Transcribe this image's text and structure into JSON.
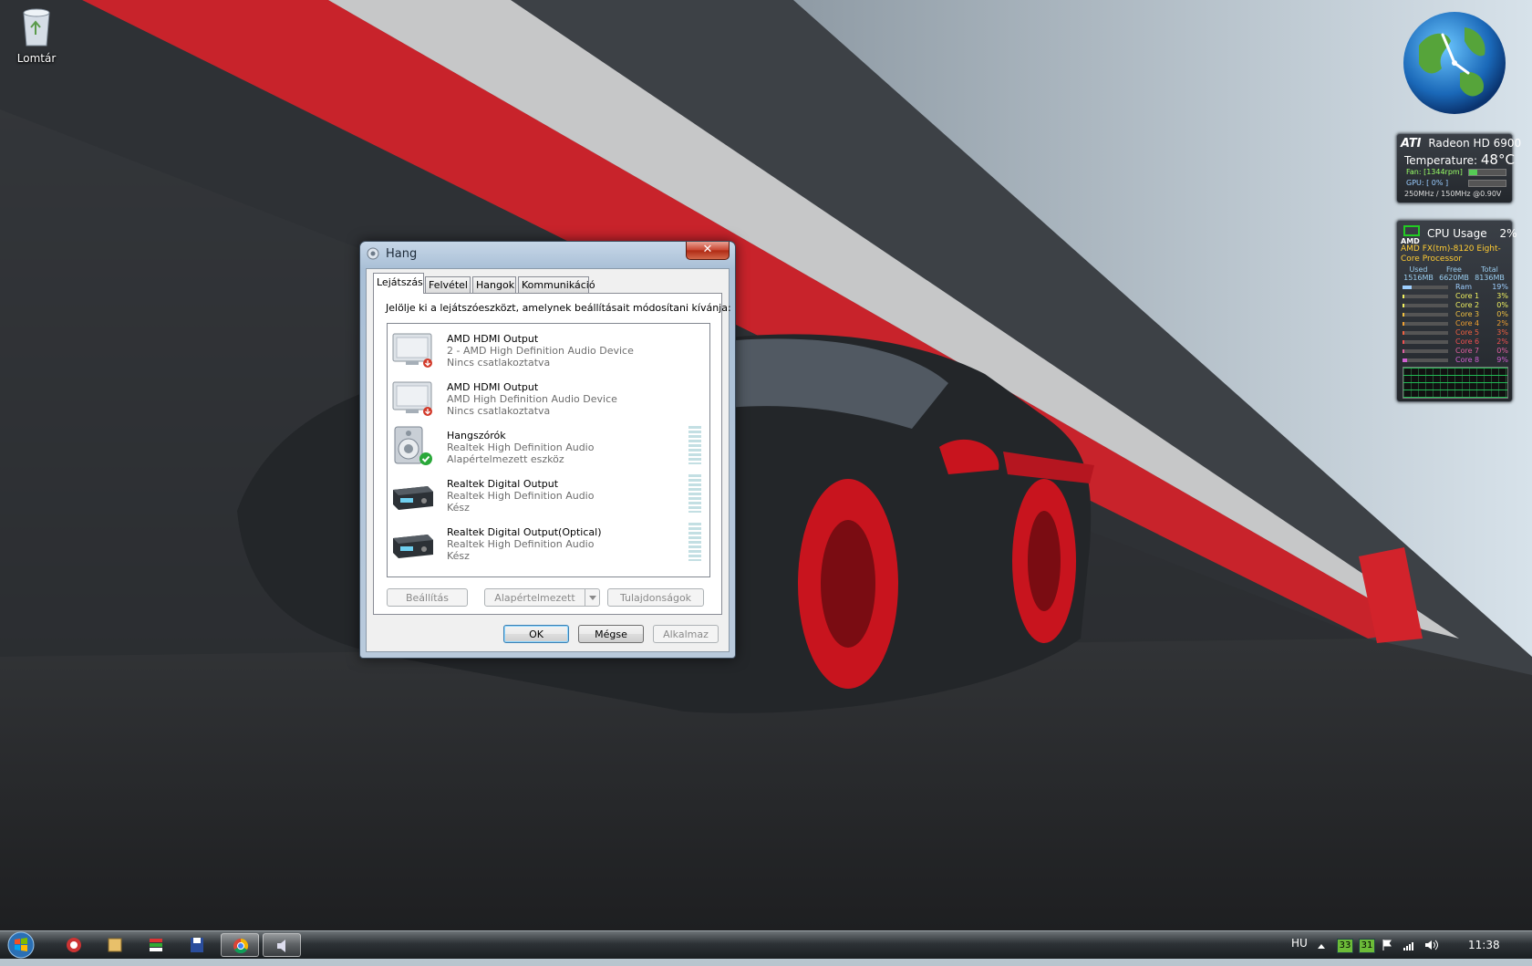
{
  "desktop": {
    "recycle_bin_label": "Lomtár"
  },
  "gadgets": {
    "gpu": {
      "brand": "ATI",
      "model": "Radeon HD 6900",
      "temperature_label": "Temperature:",
      "temperature_value": "48°C",
      "fan": "Fan: [1344rpm]",
      "gpu_load": "GPU: [ 0% ]",
      "clocks": "250MHz / 150MHz @0.90V"
    },
    "cpu": {
      "brand": "AMD",
      "title": "CPU Usage",
      "usage": "2%",
      "processor": "AMD FX(tm)-8120 Eight-Core Processor",
      "mem_headers": [
        "Used",
        "Free",
        "Total"
      ],
      "mem_values": [
        "1516MB",
        "6620MB",
        "8136MB"
      ],
      "rows": [
        {
          "name": "Ram",
          "pct": "19%",
          "color": "#9ecfff",
          "level": 0.19
        },
        {
          "name": "Core 1",
          "pct": "3%",
          "color": "#f0f060",
          "level": 0.03
        },
        {
          "name": "Core 2",
          "pct": "0%",
          "color": "#f0f060",
          "level": 0.0
        },
        {
          "name": "Core 3",
          "pct": "0%",
          "color": "#f0c040",
          "level": 0.0
        },
        {
          "name": "Core 4",
          "pct": "2%",
          "color": "#f0a030",
          "level": 0.02
        },
        {
          "name": "Core 5",
          "pct": "3%",
          "color": "#f06040",
          "level": 0.03
        },
        {
          "name": "Core 6",
          "pct": "2%",
          "color": "#f05050",
          "level": 0.02
        },
        {
          "name": "Core 7",
          "pct": "0%",
          "color": "#e060a0",
          "level": 0.0
        },
        {
          "name": "Core 8",
          "pct": "9%",
          "color": "#d060d0",
          "level": 0.09
        }
      ]
    }
  },
  "dialog": {
    "title": "Hang",
    "close_label": "✕",
    "tabs": [
      "Lejátszás",
      "Felvétel",
      "Hangok",
      "Kommunikáció"
    ],
    "instruction": "Jelölje ki a lejátszóeszközt, amelynek beállításait módosítani kívánja:",
    "devices": [
      {
        "name": "AMD HDMI Output",
        "sub": "2 - AMD High Definition Audio Device",
        "state": "Nincs csatlakoztatva",
        "icon": "monitor-icon"
      },
      {
        "name": "AMD HDMI Output",
        "sub": "AMD High Definition Audio Device",
        "state": "Nincs csatlakoztatva",
        "icon": "monitor-icon"
      },
      {
        "name": "Hangszórók",
        "sub": "Realtek High Definition Audio",
        "state": "Alapértelmezett eszköz",
        "icon": "speaker-icon"
      },
      {
        "name": "Realtek Digital Output",
        "sub": "Realtek High Definition Audio",
        "state": "Kész",
        "icon": "receiver-icon"
      },
      {
        "name": "Realtek Digital Output(Optical)",
        "sub": "Realtek High Definition Audio",
        "state": "Kész",
        "icon": "receiver-icon"
      }
    ],
    "buttons": {
      "configure": "Beállítás",
      "set_default": "Alapértelmezett",
      "properties": "Tulajdonságok",
      "ok": "OK",
      "cancel": "Mégse",
      "apply": "Alkalmaz"
    }
  },
  "taskbar": {
    "language": "HU",
    "tray_badges": [
      "33",
      "31"
    ],
    "clock": "11:38"
  }
}
